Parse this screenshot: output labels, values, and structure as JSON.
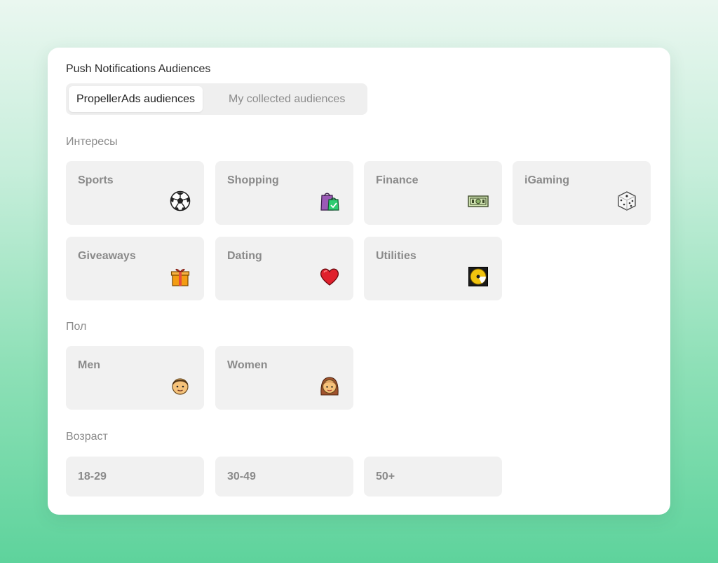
{
  "panel": {
    "title": "Push Notifications Audiences",
    "tabs": [
      {
        "label": "PropellerAds audiences",
        "active": true
      },
      {
        "label": "My collected audiences",
        "active": false
      }
    ]
  },
  "sections": {
    "interests": {
      "label": "Интересы",
      "items": [
        {
          "label": "Sports",
          "icon": "soccer-ball-icon"
        },
        {
          "label": "Shopping",
          "icon": "shopping-bags-icon"
        },
        {
          "label": "Finance",
          "icon": "banknote-icon"
        },
        {
          "label": "iGaming",
          "icon": "dice-icon"
        },
        {
          "label": "Giveaways",
          "icon": "gift-icon"
        },
        {
          "label": "Dating",
          "icon": "heart-icon"
        },
        {
          "label": "Utilities",
          "icon": "optical-disc-icon"
        }
      ]
    },
    "gender": {
      "label": "Пол",
      "items": [
        {
          "label": "Men",
          "icon": "man-face-icon"
        },
        {
          "label": "Women",
          "icon": "woman-face-icon"
        }
      ]
    },
    "age": {
      "label": "Возраст",
      "items": [
        {
          "label": "18-29"
        },
        {
          "label": "30-49"
        },
        {
          "label": "50+"
        }
      ]
    }
  },
  "colors": {
    "card_bg": "#f1f1f1",
    "card_text": "#8a8a8a",
    "section_label": "#8a8a8a",
    "tab_active_bg": "#ffffff",
    "tab_track_bg": "#efefef"
  }
}
